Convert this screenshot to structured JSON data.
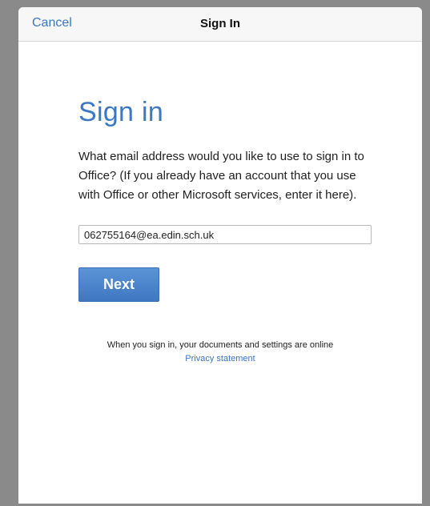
{
  "navbar": {
    "cancel_label": "Cancel",
    "title": "Sign In"
  },
  "main": {
    "heading": "Sign in",
    "description": "What email address would you like to use to sign in to Office? (If you already have an account that you use with Office or other Microsoft services, enter it here).",
    "email_value": "062755164@ea.edin.sch.uk",
    "next_label": "Next"
  },
  "footer": {
    "notice": "When you sign in, your documents and settings are online",
    "privacy_link": "Privacy statement"
  },
  "colors": {
    "accent": "#3b78c3",
    "button": "#4a86cd",
    "backdrop": "#8a8a8a"
  }
}
